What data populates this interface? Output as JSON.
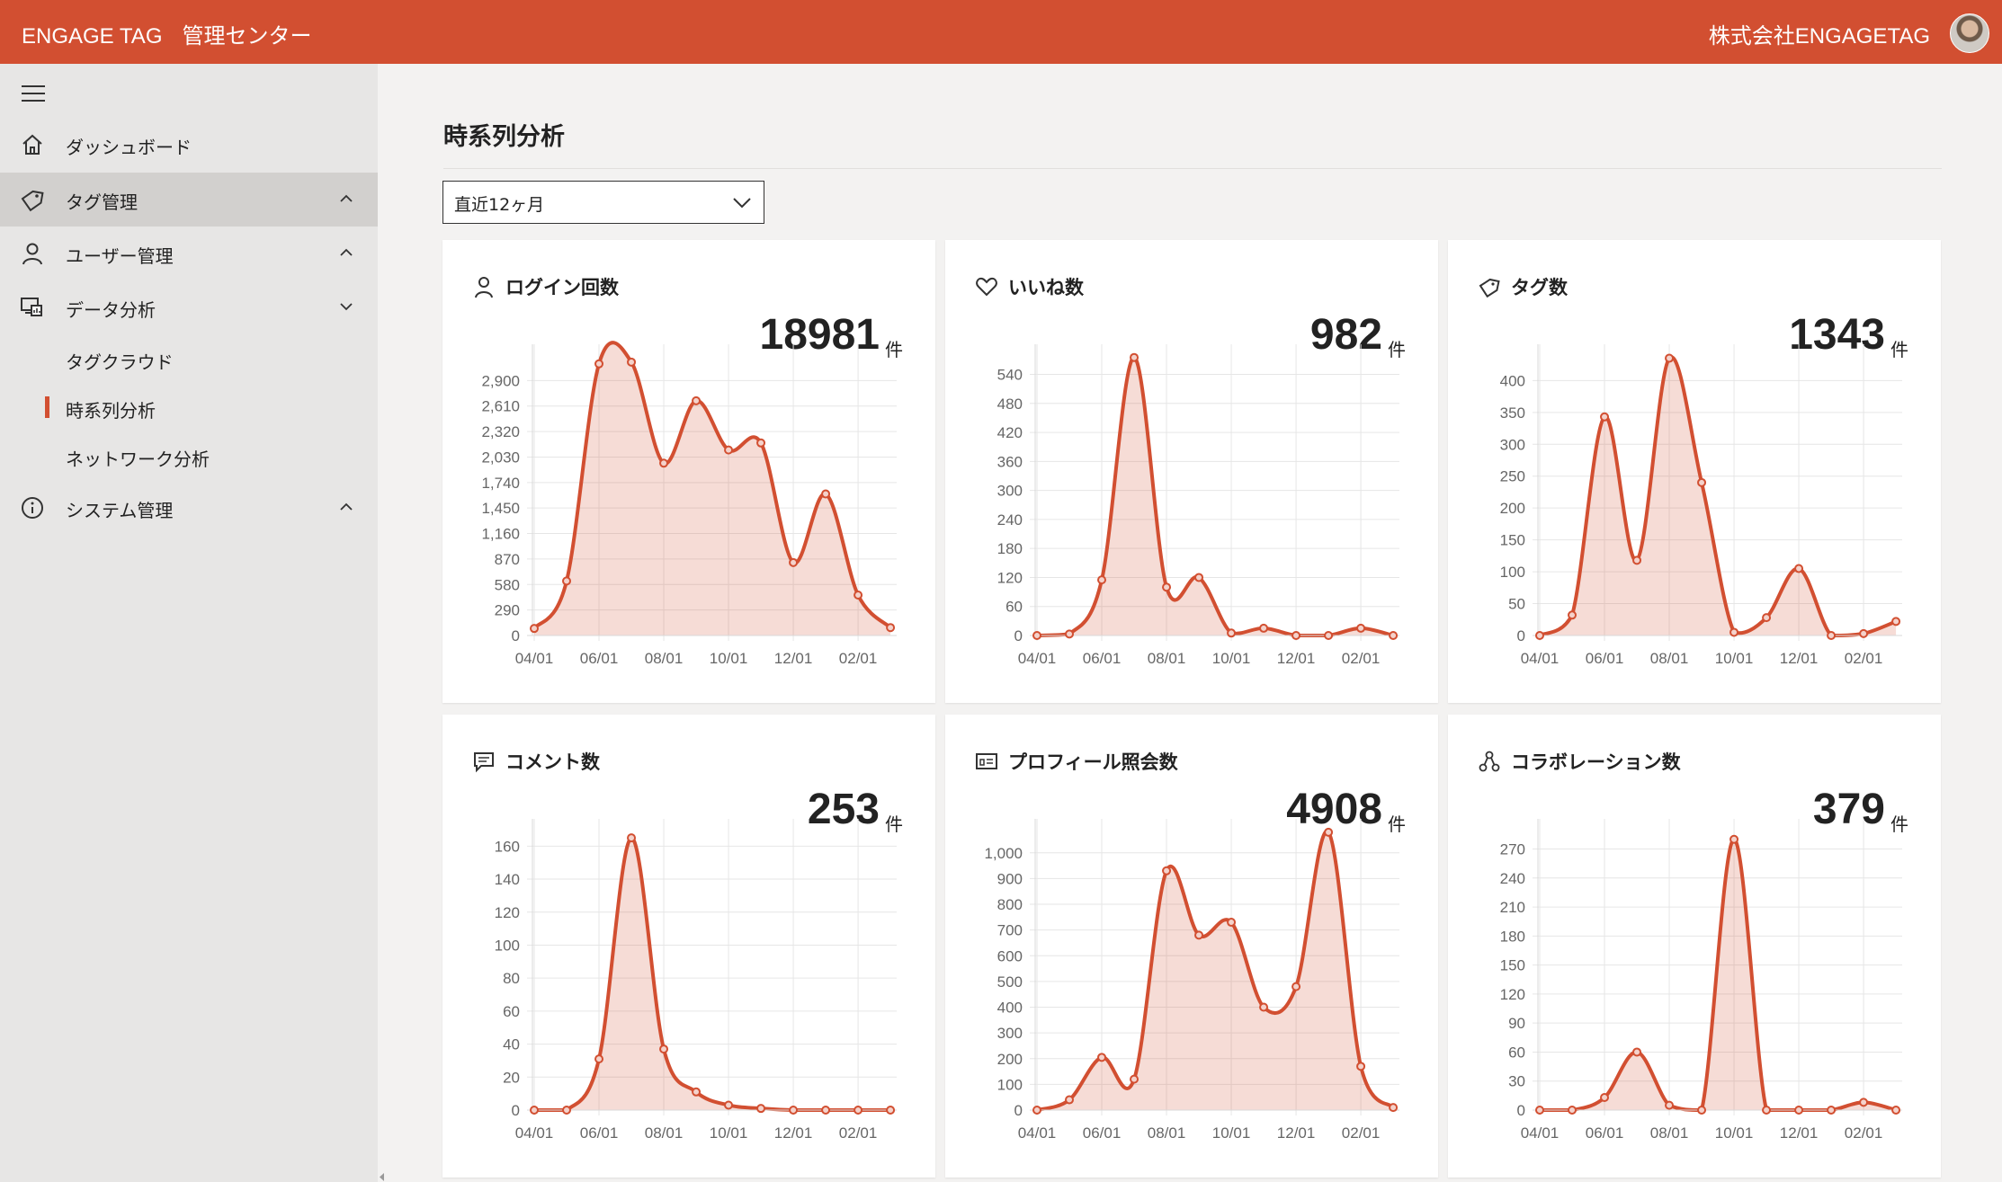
{
  "header": {
    "brand": "ENGAGE TAG",
    "subtitle": "管理センター",
    "company": "株式会社ENGAGETAG",
    "accent": "#d24f31"
  },
  "sidebar": {
    "items": [
      {
        "label": "ダッシュボード",
        "icon": "home-icon"
      },
      {
        "label": "タグ管理",
        "icon": "tag-icon",
        "chevron": "up"
      },
      {
        "label": "ユーザー管理",
        "icon": "user-icon",
        "chevron": "up"
      },
      {
        "label": "データ分析",
        "icon": "data-analysis-icon",
        "chevron": "down"
      },
      {
        "label": "システム管理",
        "icon": "info-icon",
        "chevron": "up"
      }
    ],
    "subitems": [
      {
        "label": "タグクラウド"
      },
      {
        "label": "時系列分析",
        "selected": true
      },
      {
        "label": "ネットワーク分析"
      }
    ]
  },
  "main": {
    "title": "時系列分析",
    "period": "直近12ヶ月"
  },
  "unit": "件",
  "chart_data": [
    {
      "type": "area",
      "title": "ログイン回数",
      "total": "18981",
      "x": [
        "04/01",
        "05/01",
        "06/01",
        "07/01",
        "08/01",
        "09/01",
        "10/01",
        "11/01",
        "12/01",
        "01/01",
        "02/01",
        "03/01"
      ],
      "xticks": [
        "04/01",
        "06/01",
        "08/01",
        "10/01",
        "12/01",
        "02/01"
      ],
      "yticks": [
        "0",
        "290",
        "580",
        "870",
        "1,160",
        "1,450",
        "1,740",
        "2,030",
        "2,320",
        "2,610",
        "2,900"
      ],
      "ylim": [
        0,
        3190
      ],
      "values": [
        80,
        620,
        3090,
        3110,
        1960,
        2670,
        2110,
        2190,
        830,
        1610,
        460,
        90
      ]
    },
    {
      "type": "area",
      "title": "いいね数",
      "total": "982",
      "x": [
        "04/01",
        "05/01",
        "06/01",
        "07/01",
        "08/01",
        "09/01",
        "10/01",
        "11/01",
        "12/01",
        "01/01",
        "02/01",
        "03/01"
      ],
      "xticks": [
        "04/01",
        "06/01",
        "08/01",
        "10/01",
        "12/01",
        "02/01"
      ],
      "yticks": [
        "0",
        "60",
        "120",
        "180",
        "240",
        "300",
        "360",
        "420",
        "480",
        "540"
      ],
      "ylim": [
        0,
        580
      ],
      "values": [
        0,
        3,
        115,
        575,
        100,
        120,
        5,
        15,
        0,
        0,
        15,
        0
      ]
    },
    {
      "type": "area",
      "title": "タグ数",
      "total": "1343",
      "x": [
        "04/01",
        "05/01",
        "06/01",
        "07/01",
        "08/01",
        "09/01",
        "10/01",
        "11/01",
        "12/01",
        "01/01",
        "02/01",
        "03/01"
      ],
      "xticks": [
        "04/01",
        "06/01",
        "08/01",
        "10/01",
        "12/01",
        "02/01"
      ],
      "yticks": [
        "0",
        "50",
        "100",
        "150",
        "200",
        "250",
        "300",
        "350",
        "400"
      ],
      "ylim": [
        0,
        440
      ],
      "values": [
        0,
        32,
        343,
        118,
        435,
        240,
        5,
        28,
        105,
        0,
        3,
        22
      ]
    },
    {
      "type": "area",
      "title": "コメント数",
      "total": "253",
      "x": [
        "04/01",
        "05/01",
        "06/01",
        "07/01",
        "08/01",
        "09/01",
        "10/01",
        "11/01",
        "12/01",
        "01/01",
        "02/01",
        "03/01"
      ],
      "xticks": [
        "04/01",
        "06/01",
        "08/01",
        "10/01",
        "12/01",
        "02/01"
      ],
      "yticks": [
        "0",
        "20",
        "40",
        "60",
        "80",
        "100",
        "120",
        "140",
        "160"
      ],
      "ylim": [
        0,
        170
      ],
      "values": [
        0,
        0,
        31,
        165,
        37,
        11,
        3,
        1,
        0,
        0,
        0,
        0
      ]
    },
    {
      "type": "area",
      "title": "プロフィール照会数",
      "total": "4908",
      "x": [
        "04/01",
        "05/01",
        "06/01",
        "07/01",
        "08/01",
        "09/01",
        "10/01",
        "11/01",
        "12/01",
        "01/01",
        "02/01",
        "03/01"
      ],
      "xticks": [
        "04/01",
        "06/01",
        "08/01",
        "10/01",
        "12/01",
        "02/01"
      ],
      "yticks": [
        "0",
        "100",
        "200",
        "300",
        "400",
        "500",
        "600",
        "700",
        "800",
        "900",
        "1,000"
      ],
      "ylim": [
        0,
        1090
      ],
      "values": [
        0,
        40,
        205,
        120,
        930,
        680,
        730,
        400,
        480,
        1080,
        170,
        10
      ]
    },
    {
      "type": "area",
      "title": "コラボレーション数",
      "total": "379",
      "x": [
        "04/01",
        "05/01",
        "06/01",
        "07/01",
        "08/01",
        "09/01",
        "10/01",
        "11/01",
        "12/01",
        "01/01",
        "02/01",
        "03/01"
      ],
      "xticks": [
        "04/01",
        "06/01",
        "08/01",
        "10/01",
        "12/01",
        "02/01"
      ],
      "yticks": [
        "0",
        "30",
        "60",
        "90",
        "120",
        "150",
        "180",
        "210",
        "240",
        "270"
      ],
      "ylim": [
        0,
        290
      ],
      "values": [
        0,
        0,
        13,
        60,
        5,
        0,
        280,
        0,
        0,
        0,
        8,
        0
      ]
    }
  ]
}
